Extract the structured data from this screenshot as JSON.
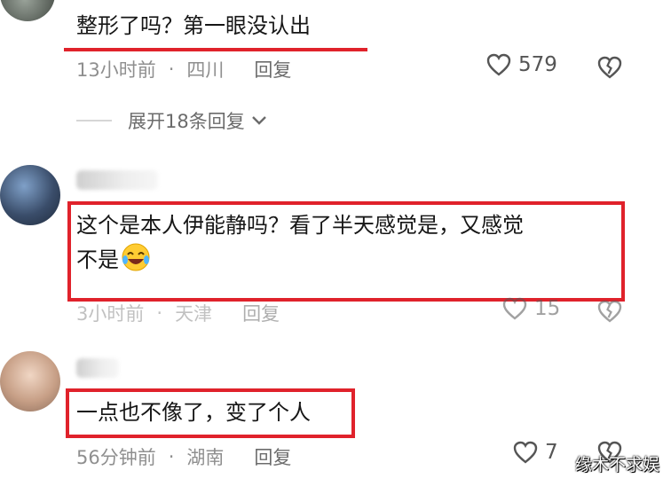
{
  "comments": [
    {
      "text": "整形了吗？第一眼没认出",
      "time": "13小时前",
      "location": "四川",
      "reply_label": "回复",
      "likes": "579",
      "expand_label": "展开18条回复"
    },
    {
      "text_line1": "这个是本人伊能静吗？看了半天感觉是，又感觉",
      "text_line2": "不是",
      "emoji": "laughing-crying-emoji",
      "time": "3小时前",
      "location": "天津",
      "reply_label": "回复",
      "likes": "15"
    },
    {
      "text": "一点也不像了，变了个人",
      "time": "56分钟前",
      "location": "湖南",
      "reply_label": "回复",
      "likes": "7"
    }
  ],
  "separator": "·",
  "watermark": "缘木不求娱",
  "colors": {
    "highlight": "#e0222b",
    "meta": "#8f8f8f"
  }
}
